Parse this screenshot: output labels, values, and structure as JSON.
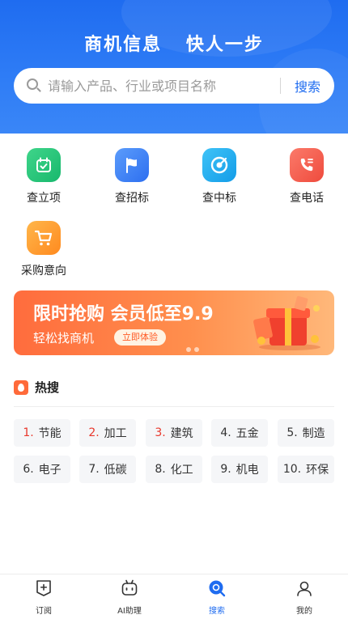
{
  "header": {
    "slogan_left": "商机信息",
    "slogan_right": "快人一步",
    "bg_color": "#1f6cf0"
  },
  "search": {
    "placeholder": "请输入产品、行业或项目名称",
    "button_label": "搜索",
    "icon": "search-icon"
  },
  "quick_actions": [
    {
      "label": "查立项",
      "icon": "calendar-check-icon",
      "color": "#18b86d"
    },
    {
      "label": "查招标",
      "icon": "flag-icon",
      "color": "#2d6ff0"
    },
    {
      "label": "查中标",
      "icon": "target-icon",
      "color": "#139ce8"
    },
    {
      "label": "查电话",
      "icon": "phone-icon",
      "color": "#ef4b3d"
    },
    {
      "label": "采购意向",
      "icon": "cart-icon",
      "color": "#ff8a1f"
    }
  ],
  "banner": {
    "title": "限时抢购 会员低至9.9",
    "subtitle": "轻松找商机",
    "cta": "立即体验"
  },
  "hot_search": {
    "title": "热搜",
    "icon": "fire-icon",
    "items": [
      {
        "num": "1.",
        "label": "节能",
        "highlight": true
      },
      {
        "num": "2.",
        "label": "加工",
        "highlight": true
      },
      {
        "num": "3.",
        "label": "建筑",
        "highlight": true
      },
      {
        "num": "4.",
        "label": "五金",
        "highlight": false
      },
      {
        "num": "5.",
        "label": "制造",
        "highlight": false
      },
      {
        "num": "6.",
        "label": "电子",
        "highlight": false
      },
      {
        "num": "7.",
        "label": "低碳",
        "highlight": false
      },
      {
        "num": "8.",
        "label": "化工",
        "highlight": false
      },
      {
        "num": "9.",
        "label": "机电",
        "highlight": false
      },
      {
        "num": "10.",
        "label": "环保",
        "highlight": false
      }
    ]
  },
  "bottom_nav": [
    {
      "label": "订阅",
      "icon": "subscribe-icon",
      "active": false
    },
    {
      "label": "AI助理",
      "icon": "robot-icon",
      "active": false
    },
    {
      "label": "搜索",
      "icon": "search-icon",
      "active": true
    },
    {
      "label": "我的",
      "icon": "user-icon",
      "active": false
    }
  ],
  "colors": {
    "accent": "#1f6cf0",
    "hot_red": "#e8382c",
    "banner_orange": "#ff6c3d"
  }
}
